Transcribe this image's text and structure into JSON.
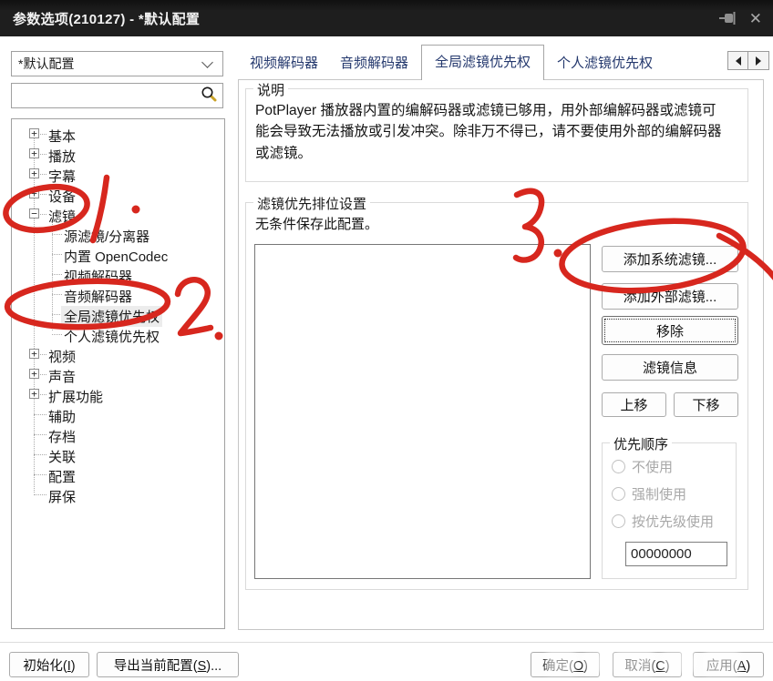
{
  "window": {
    "title": "参数选项(210127) - *默认配置"
  },
  "profile_combo": {
    "value": "*默认配置"
  },
  "search": {
    "value": ""
  },
  "tree": {
    "items": [
      {
        "label": "基本",
        "level": 0,
        "expand": "plus",
        "selected": false
      },
      {
        "label": "播放",
        "level": 0,
        "expand": "plus",
        "selected": false
      },
      {
        "label": "字幕",
        "level": 0,
        "expand": "plus",
        "selected": false
      },
      {
        "label": "设备",
        "level": 0,
        "expand": "plus",
        "selected": false
      },
      {
        "label": "滤镜",
        "level": 0,
        "expand": "minus",
        "selected": false
      },
      {
        "label": "源滤镜/分离器",
        "level": 1,
        "expand": "none",
        "selected": false
      },
      {
        "label": "内置 OpenCodec",
        "level": 1,
        "expand": "none",
        "selected": false
      },
      {
        "label": "视频解码器",
        "level": 1,
        "expand": "none",
        "selected": false
      },
      {
        "label": "音频解码器",
        "level": 1,
        "expand": "none",
        "selected": false
      },
      {
        "label": "全局滤镜优先权",
        "level": 1,
        "expand": "none",
        "selected": true
      },
      {
        "label": "个人滤镜优先权",
        "level": 1,
        "expand": "none",
        "selected": false
      },
      {
        "label": "视频",
        "level": 0,
        "expand": "plus",
        "selected": false
      },
      {
        "label": "声音",
        "level": 0,
        "expand": "plus",
        "selected": false
      },
      {
        "label": "扩展功能",
        "level": 0,
        "expand": "plus",
        "selected": false
      },
      {
        "label": "辅助",
        "level": 0,
        "expand": "none",
        "selected": false
      },
      {
        "label": "存档",
        "level": 0,
        "expand": "none",
        "selected": false
      },
      {
        "label": "关联",
        "level": 0,
        "expand": "none",
        "selected": false
      },
      {
        "label": "配置",
        "level": 0,
        "expand": "none",
        "selected": false
      },
      {
        "label": "屏保",
        "level": 0,
        "expand": "none",
        "selected": false
      }
    ]
  },
  "tabs": {
    "items": [
      "视频解码器",
      "音频解码器",
      "全局滤镜优先权",
      "个人滤镜优先权"
    ],
    "active_index": 2
  },
  "description_group": {
    "title": "说明",
    "text": "PotPlayer 播放器内置的编解码器或滤镜已够用，用外部编解码器或滤镜可能会导致无法播放或引发冲突。除非万不得已，请不要使用外部的编解码器或滤镜。"
  },
  "filter_group": {
    "title": "滤镜优先排位设置",
    "note": "无条件保存此配置。",
    "buttons": {
      "add_system": "添加系统滤镜...",
      "add_external": "添加外部滤镜...",
      "remove": "移除",
      "filter_info": "滤镜信息",
      "move_up": "上移",
      "move_down": "下移"
    }
  },
  "priority_group": {
    "title": "优先顺序",
    "options": [
      "不使用",
      "强制使用",
      "按优先级使用"
    ],
    "priority_value": "00000000"
  },
  "footer": {
    "init": {
      "pre": "初始化(",
      "key": "I",
      "post": ")"
    },
    "export": {
      "pre": "导出当前配置(",
      "key": "S",
      "post": ")..."
    },
    "ok": {
      "pre": "确定(",
      "key": "O",
      "post": ")"
    },
    "cancel": {
      "pre": "取消(",
      "key": "C",
      "post": ")"
    },
    "apply": {
      "pre": "应用(",
      "key": "A",
      "post": ")"
    }
  },
  "annotations": {
    "color": "#d7271e",
    "steps": [
      "1",
      "2",
      "3"
    ]
  }
}
